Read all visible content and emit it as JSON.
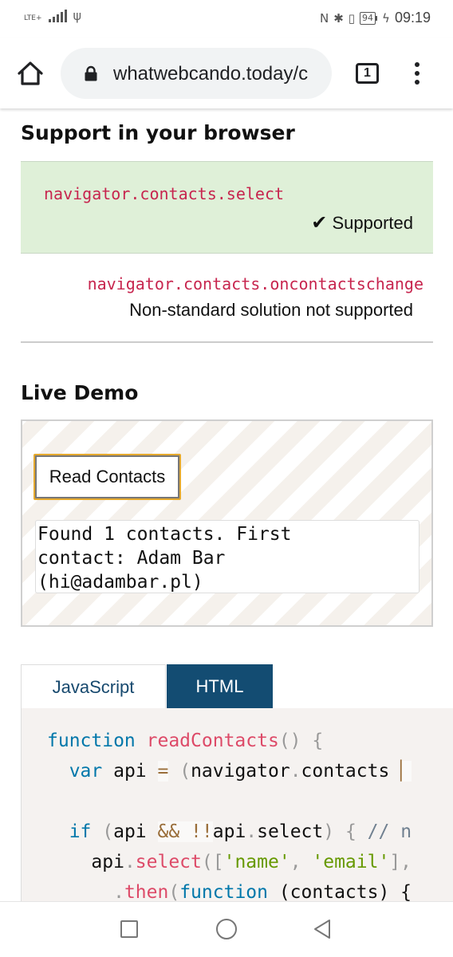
{
  "status_bar": {
    "network_label": "LTE+",
    "battery_level": "94",
    "time": "09:19"
  },
  "browser": {
    "url": "whatwebcando.today/c",
    "tab_count": "1"
  },
  "support_section": {
    "title": "Support in your browser",
    "features": [
      {
        "api": "navigator.contacts.select",
        "check_mark": "✔",
        "status": "Supported"
      },
      {
        "api": "navigator.contacts.oncontactschange",
        "status": "Non-standard solution not supported"
      }
    ]
  },
  "demo_section": {
    "title": "Live Demo",
    "button_label": "Read Contacts",
    "output_text": "Found 1 contacts. First\ncontact: Adam Bar\n(hi@adambar.pl)"
  },
  "code_tabs": {
    "tabs": [
      {
        "label": "JavaScript",
        "active": false
      },
      {
        "label": "HTML",
        "active": true
      }
    ]
  },
  "code": {
    "l1_kw": "function",
    "l1_fn": "readContacts",
    "l1_rest": "()",
    "l1_brace": " {",
    "l2_kw": "var",
    "l2_name": " api ",
    "l2_op": "=",
    "l2_paren": " (",
    "l2_obj": "navigator",
    "l2_dot": ".",
    "l2_prop": "contacts ",
    "l4_kw": "if",
    "l4_paren": " (",
    "l4_api": "api ",
    "l4_and": "&&",
    "l4_not": " !!",
    "l4_api2": "api",
    "l4_dot": ".",
    "l4_select": "select",
    "l4_close": ")",
    "l4_brace": " {",
    "l4_comment": " // n",
    "l5_api": "api",
    "l5_dot": ".",
    "l5_fn": "select",
    "l5_open": "([",
    "l5_s1": "'name'",
    "l5_comma": ", ",
    "l5_s2": "'email'",
    "l5_close": "],",
    "l6_dot": ".",
    "l6_fn": "then",
    "l6_open": "(",
    "l6_kw": "function",
    "l6_args": " (contacts) {"
  },
  "icons": {
    "home": "home-icon",
    "lock": "lock-icon",
    "menu": "more-vert-icon",
    "recents": "square-icon",
    "home_nav": "circle-icon",
    "back": "triangle-back-icon"
  },
  "colors": {
    "supported_bg": "#dff0d8",
    "api_name": "#c7254e",
    "active_tab": "#134c72",
    "button_focus": "#e5a92e"
  }
}
